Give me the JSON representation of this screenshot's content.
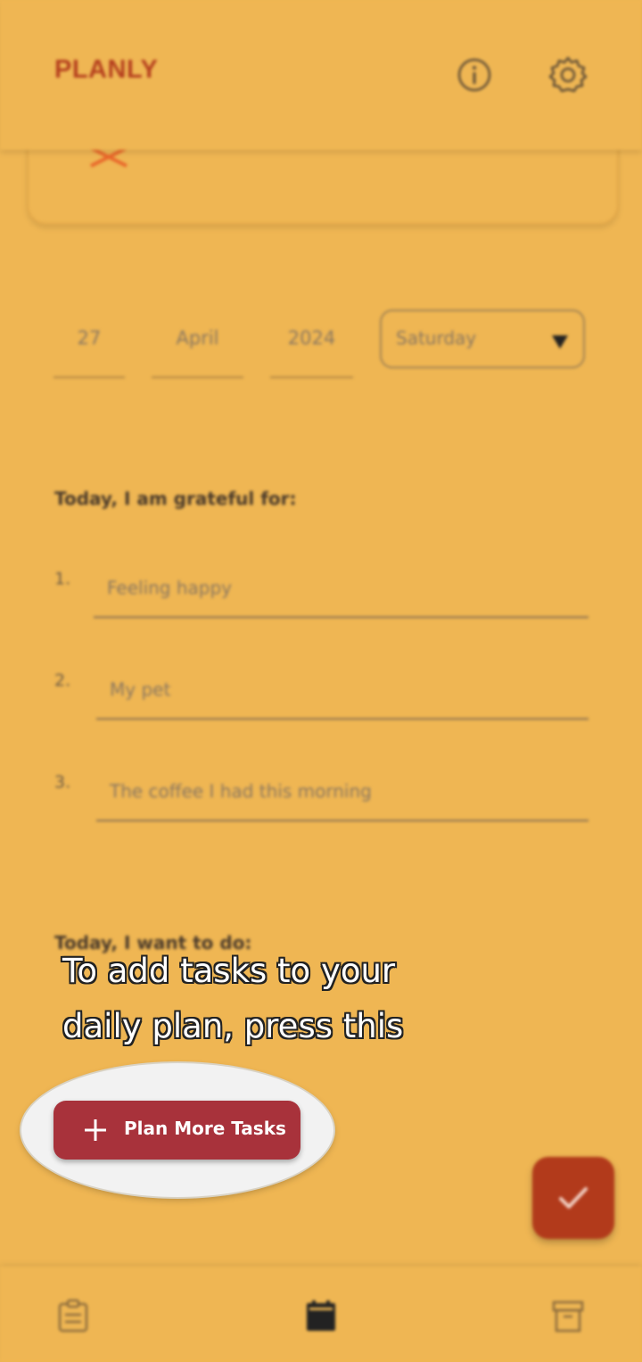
{
  "app": {
    "title": "PLANLY"
  },
  "appbar": {
    "icons": [
      "info-icon",
      "gear-icon"
    ]
  },
  "date": {
    "day": "27",
    "month": "April",
    "year": "2024",
    "weekday": "Saturday"
  },
  "grateful": {
    "heading": "Today, I am grateful for:",
    "items": [
      {
        "number": "1.",
        "text": "Feeling happy"
      },
      {
        "number": "2.",
        "text": "My pet"
      },
      {
        "number": "3.",
        "text": "The coffee I had this morning"
      }
    ]
  },
  "todo": {
    "heading": "Today, I want to do:"
  },
  "tooltip": {
    "line1": "To add tasks to your",
    "line2": "daily plan, press this"
  },
  "plan_button": {
    "label": "Plan More Tasks",
    "icon": "plus-icon",
    "color": "#a8323b"
  },
  "fab": {
    "icon": "check-icon",
    "color": "#b23a1b"
  },
  "bottom_nav": {
    "icons": [
      "clipboard-icon",
      "calendar-icon",
      "archive-icon"
    ]
  },
  "colors": {
    "background": "#efb653",
    "title": "#b5401e"
  }
}
